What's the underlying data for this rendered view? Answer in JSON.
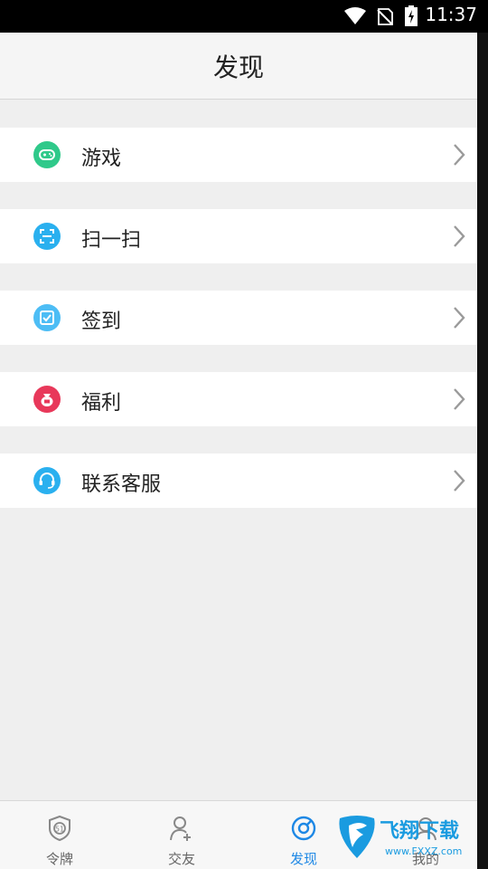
{
  "status_bar": {
    "time": "11:37"
  },
  "header": {
    "title": "发现"
  },
  "menu": [
    {
      "label": "游戏",
      "icon": "gamepad-icon",
      "color": "#2fc98a"
    },
    {
      "label": "扫一扫",
      "icon": "scan-icon",
      "color": "#2ab0ef"
    },
    {
      "label": "签到",
      "icon": "checkin-icon",
      "color": "#4dbdf5"
    },
    {
      "label": "福利",
      "icon": "gift-bag-icon",
      "color": "#e8385a"
    },
    {
      "label": "联系客服",
      "icon": "headset-icon",
      "color": "#2ab0ef"
    }
  ],
  "tabs": [
    {
      "label": "令牌",
      "icon": "token-shield-icon",
      "active": false
    },
    {
      "label": "交友",
      "icon": "add-friend-icon",
      "active": false
    },
    {
      "label": "发现",
      "icon": "discover-icon",
      "active": true
    },
    {
      "label": "我的",
      "icon": "profile-icon",
      "active": false
    }
  ],
  "watermark": {
    "text": "飞翔下载",
    "sub": "www.FXXZ.com"
  },
  "colors": {
    "accent": "#1e88e5",
    "background": "#efefef"
  }
}
